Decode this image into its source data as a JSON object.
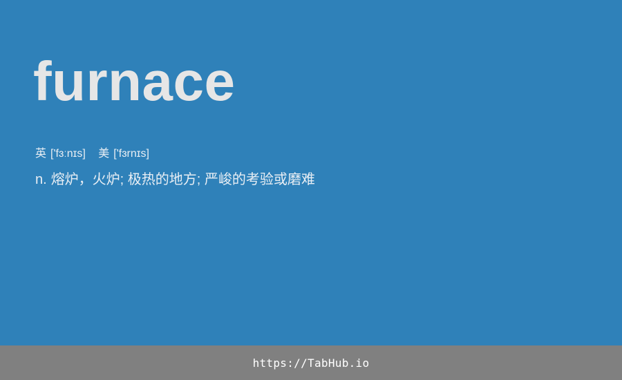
{
  "card": {
    "word": "furnace",
    "phonetics": {
      "uk_label": "英",
      "uk": "['fɜːnɪs]",
      "us_label": "美",
      "us": "['fɜrnɪs]"
    },
    "definition": {
      "pos": "n.",
      "text": "熔炉，火炉; 极热的地方; 严峻的考验或磨难"
    }
  },
  "footer": {
    "link": "https://TabHub.io"
  },
  "colors": {
    "background": "#2f81b9",
    "footer": "#808080",
    "word_text": "#e6e6e6"
  }
}
